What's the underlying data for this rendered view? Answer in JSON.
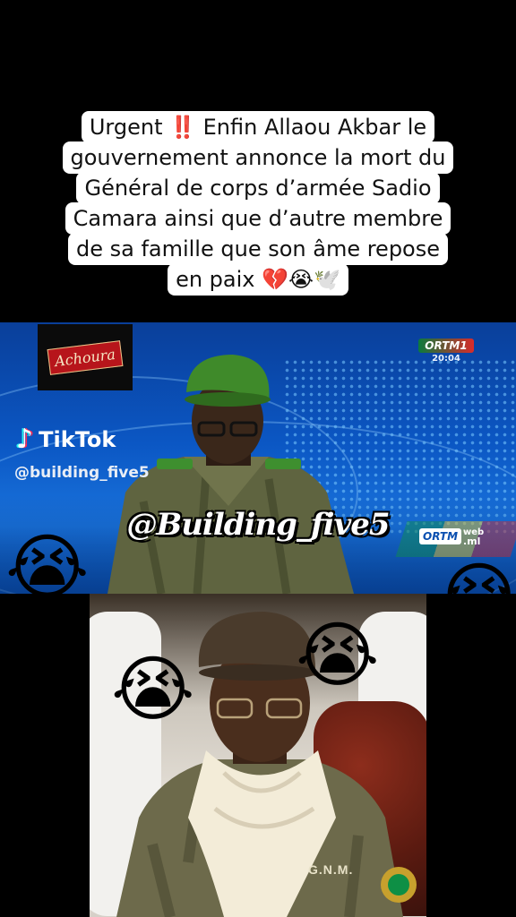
{
  "caption": {
    "lines": [
      "Urgent ‼️ Enfin Allaou Akbar le",
      "gouvernement annonce la mort du",
      "Général de corps d’armée Sadio",
      "Camara ainsi que d’autre membre",
      "de sa famille que son âme repose",
      "en paix 💔😭🕊️"
    ]
  },
  "broadcast": {
    "logo_text": "Achoura",
    "channel_top": "ORTM",
    "channel_top_num": "1",
    "clock": "20:04",
    "channel_bottom": "ORTM",
    "channel_bottom_web": "web",
    "channel_bottom_ml": ".ml"
  },
  "tiktok": {
    "brand": "TikTok",
    "handle": "@building_five5"
  },
  "overlay_handle": "@Building_five5",
  "uniform_tag": "G.N.M.",
  "emoji": {
    "crying": "😭",
    "sad": "😰"
  },
  "colors": {
    "background": "#000000",
    "caption_bg": "#ffffff",
    "broadcast_blue": "#0b57c4",
    "beret_green": "#3f8a2a",
    "beret_brown": "#4a3b2c"
  }
}
